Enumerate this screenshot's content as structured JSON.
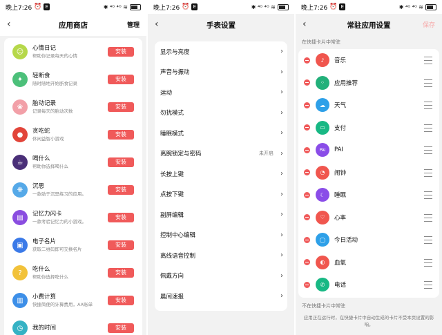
{
  "status": {
    "time": "晚上7:26",
    "icons": "✱ ⁴ᴳ ⁴ᴳ ≋"
  },
  "panel1": {
    "title": "应用商店",
    "action": "管理",
    "install_label": "安装",
    "apps": [
      {
        "name": "心情日记",
        "desc": "帮助你记录每天的心情",
        "icon": "mood-diary-icon",
        "color": "#b6d84a",
        "glyph": "☺"
      },
      {
        "name": "轻断食",
        "desc": "随时随地开始断食记录",
        "icon": "fasting-icon",
        "color": "#4cc07a",
        "glyph": "✦"
      },
      {
        "name": "胎动记录",
        "desc": "记录每天的胎动次数",
        "icon": "fetal-movement-icon",
        "color": "#f2a0a8",
        "glyph": "❀"
      },
      {
        "name": "贪吃蛇",
        "desc": "休闲益智小游戏",
        "icon": "snake-game-icon",
        "color": "#e2453a",
        "glyph": "●"
      },
      {
        "name": "喝什么",
        "desc": "帮助你选择喝什么",
        "icon": "drink-icon",
        "color": "#4a2f78",
        "glyph": "☕"
      },
      {
        "name": "沉思",
        "desc": "一款助于沉思练习的应用。",
        "icon": "meditation-icon",
        "color": "#56a9e8",
        "glyph": "❋"
      },
      {
        "name": "记忆力闪卡",
        "desc": "一款考验记忆力的小游戏。",
        "icon": "memory-card-icon",
        "color": "#8a4de0",
        "glyph": "▤"
      },
      {
        "name": "电子名片",
        "desc": "获取二维码即可交换名片",
        "icon": "business-card-icon",
        "color": "#3b7ae8",
        "glyph": "▣"
      },
      {
        "name": "吃什么",
        "desc": "帮助你选择吃什么",
        "icon": "food-icon",
        "color": "#f2c23a",
        "glyph": "?"
      },
      {
        "name": "小费计算",
        "desc": "快捷简便的计算费用，AA账单",
        "icon": "tip-calculator-icon",
        "color": "#3d8fe8",
        "glyph": "▥"
      },
      {
        "name": "我的时间",
        "desc": "",
        "icon": "my-time-icon",
        "color": "#35b2c4",
        "glyph": "◷"
      }
    ]
  },
  "panel2": {
    "title": "手表设置",
    "items": [
      {
        "label": "显示与亮度",
        "value": ""
      },
      {
        "label": "声音与振动",
        "value": ""
      },
      {
        "label": "运动",
        "value": ""
      },
      {
        "label": "勿扰模式",
        "value": ""
      },
      {
        "label": "睡眠模式",
        "value": ""
      },
      {
        "label": "离腕锁定与密码",
        "value": "未开启"
      },
      {
        "label": "长按上键",
        "value": ""
      },
      {
        "label": "点按下键",
        "value": ""
      },
      {
        "label": "副屏编辑",
        "value": ""
      },
      {
        "label": "控制中心编辑",
        "value": ""
      },
      {
        "label": "离线语音控制",
        "value": ""
      },
      {
        "label": "佩戴方向",
        "value": ""
      },
      {
        "label": "晨间速报",
        "value": ""
      }
    ]
  },
  "panel3": {
    "title": "常驻应用设置",
    "action": "保存",
    "section_on": "在快捷卡片中常驻",
    "section_off": "不在快捷卡片中常驻",
    "footer": "应用正在运行时，在快捷卡片中自动生成的卡片不受本页设置的影响。",
    "items": [
      {
        "label": "音乐",
        "icon": "music-icon",
        "color": "#f0564e",
        "glyph": "♪"
      },
      {
        "label": "应用推荐",
        "icon": "app-recommend-icon",
        "color": "#22b07a",
        "glyph": "⁘"
      },
      {
        "label": "天气",
        "icon": "weather-icon",
        "color": "#2ea0e8",
        "glyph": "☁"
      },
      {
        "label": "支付",
        "icon": "payment-icon",
        "color": "#18b884",
        "glyph": "▭"
      },
      {
        "label": "PAI",
        "icon": "pai-icon",
        "color": "#8a4de8",
        "glyph": "PAI"
      },
      {
        "label": "闹钟",
        "icon": "alarm-icon",
        "color": "#f0564e",
        "glyph": "◔"
      },
      {
        "label": "睡眠",
        "icon": "sleep-icon",
        "color": "#8a4de8",
        "glyph": "☾"
      },
      {
        "label": "心率",
        "icon": "heart-rate-icon",
        "color": "#f0564e",
        "glyph": "♡"
      },
      {
        "label": "今日活动",
        "icon": "activity-icon",
        "color": "#2ea0e8",
        "glyph": "◯"
      },
      {
        "label": "血氧",
        "icon": "blood-oxygen-icon",
        "color": "#f0564e",
        "glyph": "◐"
      },
      {
        "label": "电话",
        "icon": "phone-icon",
        "color": "#18b884",
        "glyph": "✆"
      }
    ]
  }
}
